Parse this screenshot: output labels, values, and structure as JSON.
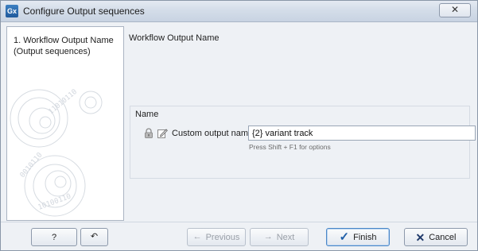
{
  "window": {
    "title": "Configure Output sequences",
    "app_icon_text": "Gx",
    "close_label": "☒"
  },
  "steps": {
    "items": [
      {
        "label": "1.  Workflow Output Name (Output sequences)"
      }
    ]
  },
  "main": {
    "heading": "Workflow Output Name",
    "group_title": "Name",
    "field_label": "Custom output name",
    "field_value": "{2} variant track",
    "hint": "Press Shift + F1 for options"
  },
  "buttons": {
    "help": "?",
    "reset_icon": "↶",
    "previous": "Previous",
    "next": "Next",
    "finish": "Finish",
    "cancel": "Cancel",
    "previous_icon": "←",
    "next_icon": "→",
    "finish_icon": "✓",
    "cancel_icon": "✕"
  },
  "colors": {
    "accent": "#4a86c7",
    "finish_check": "#1f5fa8",
    "cancel_x": "#203a6a"
  }
}
